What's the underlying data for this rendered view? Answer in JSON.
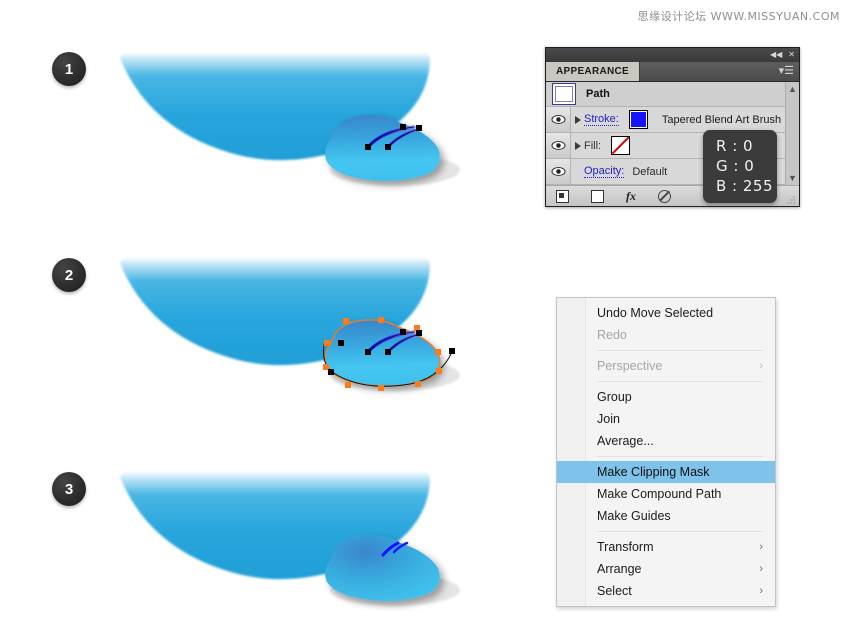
{
  "watermark": "思缘设计论坛  WWW.MISSYUAN.COM",
  "steps": [
    {
      "number": "1"
    },
    {
      "number": "2"
    },
    {
      "number": "3"
    }
  ],
  "appearance_panel": {
    "tab_label": "APPEARANCE",
    "collapse_icon": "◀◀",
    "close_icon": "✕",
    "menu_icon": "▾☰",
    "target_row_label": "Path",
    "rows": [
      {
        "label": "Stroke:",
        "value": "Tapered Blend Art Brush",
        "swatch_color": "#1414ff",
        "swatch_type": "color",
        "eye_icon": "eye-icon",
        "disclosure_icon": "triangle-right-icon"
      },
      {
        "label": "Fill:",
        "value": "",
        "swatch_color": "#ffffff",
        "swatch_type": "none",
        "eye_icon": "eye-icon",
        "disclosure_icon": "triangle-right-icon"
      },
      {
        "label": "Opacity:",
        "value": "Default",
        "swatch_type": "",
        "eye_icon": "eye-icon"
      }
    ],
    "scroll_up_icon": "▲",
    "scroll_down_icon": "▼",
    "footer_icons": [
      "add-new-stroke-icon",
      "add-new-fill-icon",
      "add-effect-fx-icon",
      "clear-appearance-icon"
    ],
    "fx_label": "fx"
  },
  "rgb_tooltip": {
    "r": "R : 0",
    "g": "G : 0",
    "b": "B : 255"
  },
  "context_menu": {
    "items": [
      {
        "label": "Undo Move Selected",
        "state": "normal",
        "submenu": false
      },
      {
        "label": "Redo",
        "state": "disabled",
        "submenu": false
      },
      {
        "separator": true
      },
      {
        "label": "Perspective",
        "state": "disabled",
        "submenu": true,
        "arrow": "›"
      },
      {
        "separator": true
      },
      {
        "label": "Group",
        "state": "normal",
        "submenu": false
      },
      {
        "label": "Join",
        "state": "normal",
        "submenu": false
      },
      {
        "label": "Average...",
        "state": "normal",
        "submenu": false
      },
      {
        "separator": true
      },
      {
        "label": "Make Clipping Mask",
        "state": "selected",
        "submenu": false
      },
      {
        "label": "Make Compound Path",
        "state": "normal",
        "submenu": false
      },
      {
        "label": "Make Guides",
        "state": "normal",
        "submenu": false
      },
      {
        "separator": true
      },
      {
        "label": "Transform",
        "state": "normal",
        "submenu": true,
        "arrow": "›"
      },
      {
        "label": "Arrange",
        "state": "normal",
        "submenu": true,
        "arrow": "›"
      },
      {
        "label": "Select",
        "state": "normal",
        "submenu": true,
        "arrow": "›"
      }
    ],
    "highlight_color": "#7fc2ea"
  },
  "artwork": {
    "dome_gradient_top": "#ffffff",
    "dome_gradient_bottom": "#1f9fd6",
    "blob_gradient_top": "#3a8fd0",
    "blob_gradient_bottom": "#3fc3ef",
    "brush_stroke_color": "#1414ff",
    "anchor_selected_color": "#ff7a18",
    "anchor_color": "#000000"
  }
}
